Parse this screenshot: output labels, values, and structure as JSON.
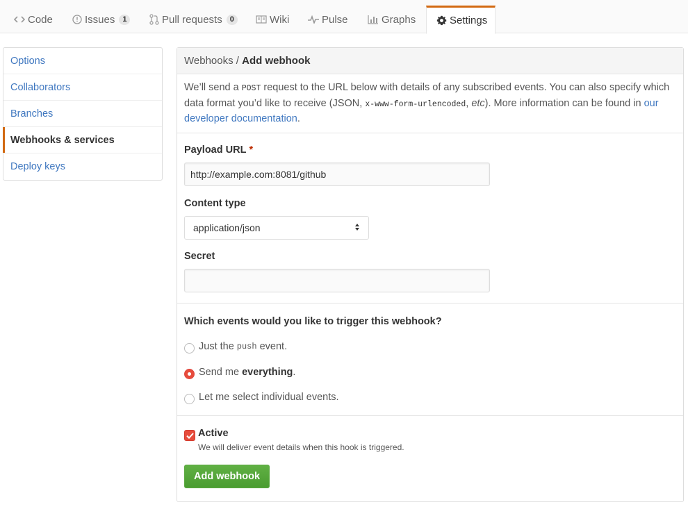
{
  "nav": {
    "tabs": [
      {
        "label": "Code",
        "icon": "code-icon"
      },
      {
        "label": "Issues",
        "icon": "issue-icon",
        "count": "1"
      },
      {
        "label": "Pull requests",
        "icon": "pull-request-icon",
        "count": "0"
      },
      {
        "label": "Wiki",
        "icon": "book-icon"
      },
      {
        "label": "Pulse",
        "icon": "pulse-icon"
      },
      {
        "label": "Graphs",
        "icon": "graph-icon"
      },
      {
        "label": "Settings",
        "icon": "gear-icon",
        "selected": true
      }
    ]
  },
  "sidebar": {
    "items": [
      {
        "label": "Options"
      },
      {
        "label": "Collaborators"
      },
      {
        "label": "Branches"
      },
      {
        "label": "Webhooks & services",
        "active": true
      },
      {
        "label": "Deploy keys"
      }
    ]
  },
  "panel": {
    "breadcrumb_parent": "Webhooks",
    "breadcrumb_sep": "/",
    "title": "Add webhook",
    "intro": {
      "p1": "We’ll send a ",
      "code1": "POST",
      "p2": " request to the URL below with details of any subscribed events. You can also specify which data format you’d like to receive (JSON, ",
      "code2": "x-www-form-urlencoded",
      "p3": ", ",
      "em": "etc",
      "p4": "). More information can be found in ",
      "link": "our developer documentation",
      "p5": "."
    },
    "payload_label": "Payload URL",
    "required_mark": "*",
    "payload_value": "http://example.com:8081/github",
    "content_type_label": "Content type",
    "content_type_value": "application/json",
    "secret_label": "Secret",
    "secret_value": "",
    "events_question": "Which events would you like to trigger this webhook?",
    "events": {
      "opt1_before": "Just the",
      "opt1_code": "push",
      "opt1_after": "event.",
      "opt2_before": "Send me ",
      "opt2_bold": "everything",
      "opt2_after": ".",
      "opt3": "Let me select individual events.",
      "selected": "everything"
    },
    "active_label": "Active",
    "active_checked": true,
    "active_help": "We will deliver event details when this hook is triggered.",
    "submit_label": "Add webhook"
  },
  "colors": {
    "accent": "#d26911",
    "link": "#4078c0",
    "primary_button": "#55a532",
    "radio_checkbox": "#e74c3c"
  }
}
